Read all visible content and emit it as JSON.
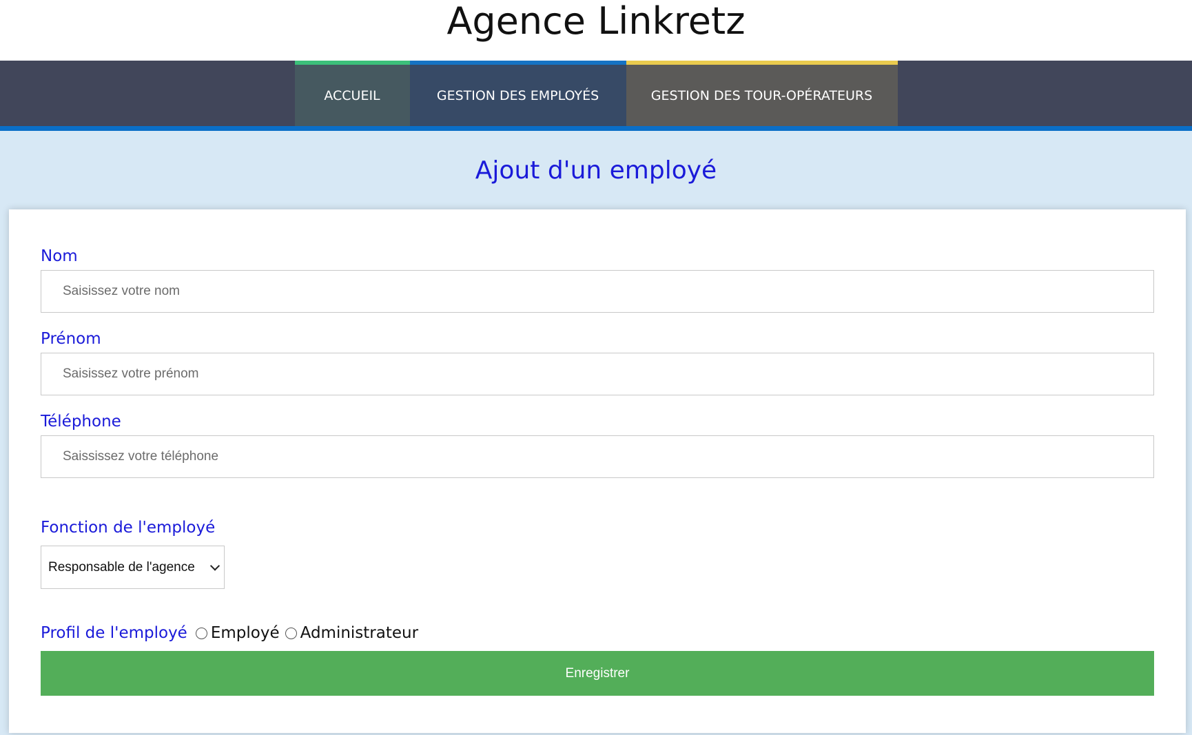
{
  "site": {
    "title": "Agence Linkretz"
  },
  "nav": {
    "tabs": [
      {
        "label": "ACCUEIL"
      },
      {
        "label": "GESTION DES EMPLOYÉS"
      },
      {
        "label": "GESTION DES TOUR-OPÉRATEURS"
      }
    ]
  },
  "page": {
    "title": "Ajout d'un employé"
  },
  "form": {
    "nom": {
      "label": "Nom",
      "placeholder": "Saisissez votre nom"
    },
    "prenom": {
      "label": "Prénom",
      "placeholder": "Saisissez votre prénom"
    },
    "telephone": {
      "label": "Téléphone",
      "placeholder": "Saississez votre téléphone"
    },
    "fonction": {
      "label": "Fonction de l'employé",
      "selected": "Responsable de l'agence"
    },
    "profil": {
      "label": "Profil de l'employé",
      "options": [
        "Employé",
        "Administrateur"
      ]
    },
    "submit_label": "Enregistrer"
  },
  "colors": {
    "accent_blue": "#1a1ad9",
    "nav_bg": "#41465a",
    "submit_green": "#53ae59",
    "tab_accueil_top": "#3cc07a",
    "tab_employes_top": "#1573c4",
    "tab_tour_top": "#eacb4e"
  }
}
